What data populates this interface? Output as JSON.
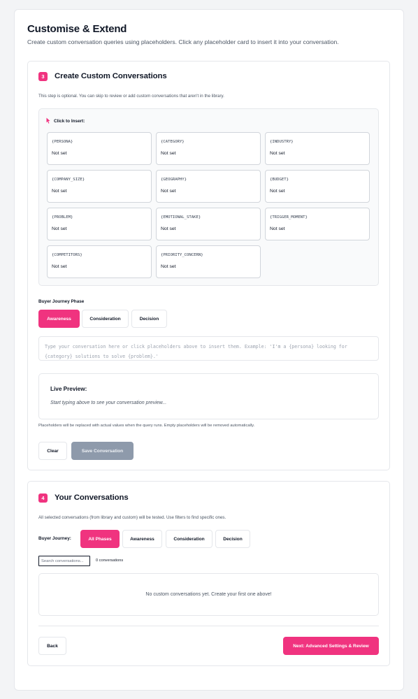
{
  "header": {
    "title": "Customise & Extend",
    "subtitle": "Create custom conversation queries using placeholders. Click any placeholder card to insert it into your conversation."
  },
  "step3": {
    "badge": "3",
    "title": "Create Custom Conversations",
    "note": "This step is optional. You can skip to review or add custom conversations that aren't in the library.",
    "insert_label": "Click to Insert:",
    "placeholders": [
      {
        "key": "{PERSONA}",
        "value": "Not set"
      },
      {
        "key": "{CATEGORY}",
        "value": "Not set"
      },
      {
        "key": "{INDUSTRY}",
        "value": "Not set"
      },
      {
        "key": "{COMPANY_SIZE}",
        "value": "Not set"
      },
      {
        "key": "{GEOGRAPHY}",
        "value": "Not set"
      },
      {
        "key": "{BUDGET}",
        "value": "Not set"
      },
      {
        "key": "{PROBLEM}",
        "value": "Not set"
      },
      {
        "key": "{EMOTIONAL_STAKE}",
        "value": "Not set"
      },
      {
        "key": "{TRIGGER_MOMENT}",
        "value": "Not set"
      },
      {
        "key": "{COMPETITORS}",
        "value": "Not set"
      },
      {
        "key": "{PRIORITY_CONCERN}",
        "value": "Not set"
      }
    ],
    "phase_label": "Buyer Journey Phase",
    "phases": [
      "Awareness",
      "Consideration",
      "Decision"
    ],
    "active_phase": "Awareness",
    "textarea_placeholder": "Type your conversation here or click placeholders above to insert them. Example: 'I'm a {persona} looking for {category} solutions to solve {problem}.'",
    "preview_title": "Live Preview:",
    "preview_text": "Start typing above to see your conversation preview...",
    "replace_note": "Placeholders will be replaced with actual values when the query runs. Empty placeholders will be removed automatically.",
    "clear_label": "Clear",
    "save_label": "Save Conversation"
  },
  "step4": {
    "badge": "4",
    "title": "Your Conversations",
    "note": "All selected conversations (from library and custom) will be tested. Use filters to find specific ones.",
    "filter_label": "Buyer Journey:",
    "filters": [
      "All Phases",
      "Awareness",
      "Consideration",
      "Decision"
    ],
    "active_filter": "All Phases",
    "search_placeholder": "Search conversations...",
    "count": "0 conversations",
    "empty_text": "No custom conversations yet. Create your first one above!"
  },
  "footer": {
    "back_label": "Back",
    "next_label": "Next: Advanced Settings & Review"
  },
  "colors": {
    "accent": "#f0337f",
    "disabled_button": "#8e9aab",
    "border": "#e5e7eb"
  }
}
